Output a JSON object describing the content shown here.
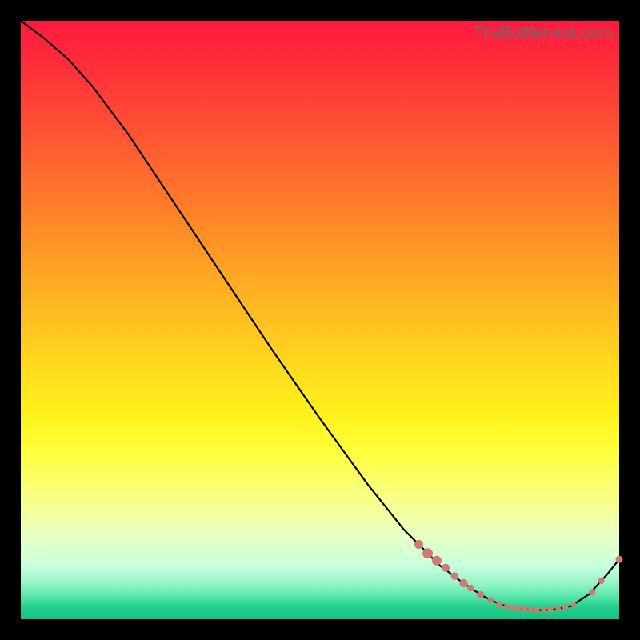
{
  "watermark": "TheBottleneck.com",
  "colors": {
    "curve": "#000000",
    "dot": "#cf7b70",
    "page_bg": "#000000"
  },
  "chart_data": {
    "type": "line",
    "title": "",
    "xlabel": "",
    "ylabel": "",
    "xlim": [
      0,
      100
    ],
    "ylim": [
      0,
      100
    ],
    "grid": false,
    "legend": false,
    "series": [
      {
        "name": "bottleneck-curve",
        "x": [
          0,
          4,
          8,
          12,
          18,
          26,
          34,
          42,
          50,
          58,
          64,
          70,
          74,
          77,
          80,
          83,
          86,
          89,
          92,
          95,
          98,
          100
        ],
        "y": [
          100,
          97,
          93.5,
          89,
          81,
          69,
          57,
          45,
          33.5,
          22.5,
          15,
          9,
          6,
          4,
          2.5,
          1.8,
          1.5,
          1.6,
          2.2,
          4.2,
          7.5,
          10
        ]
      }
    ],
    "markers": [
      {
        "x": 66.5,
        "y": 12.5,
        "r": 5.5
      },
      {
        "x": 68.0,
        "y": 11.0,
        "r": 6.5
      },
      {
        "x": 69.5,
        "y": 9.8,
        "r": 6.0
      },
      {
        "x": 71.0,
        "y": 8.6,
        "r": 5.0
      },
      {
        "x": 72.5,
        "y": 7.2,
        "r": 4.8
      },
      {
        "x": 74.0,
        "y": 6.0,
        "r": 5.2
      },
      {
        "x": 75.2,
        "y": 5.2,
        "r": 4.2
      },
      {
        "x": 76.8,
        "y": 4.1,
        "r": 4.6
      },
      {
        "x": 78.5,
        "y": 3.2,
        "r": 3.8
      },
      {
        "x": 80.0,
        "y": 2.5,
        "r": 4.2
      },
      {
        "x": 81.2,
        "y": 2.1,
        "r": 3.6
      },
      {
        "x": 82.2,
        "y": 1.9,
        "r": 4.0
      },
      {
        "x": 83.2,
        "y": 1.8,
        "r": 3.6
      },
      {
        "x": 84.2,
        "y": 1.7,
        "r": 3.8
      },
      {
        "x": 85.2,
        "y": 1.6,
        "r": 3.4
      },
      {
        "x": 86.2,
        "y": 1.5,
        "r": 3.8
      },
      {
        "x": 87.4,
        "y": 1.5,
        "r": 3.4
      },
      {
        "x": 88.5,
        "y": 1.6,
        "r": 3.8
      },
      {
        "x": 89.8,
        "y": 1.8,
        "r": 3.4
      },
      {
        "x": 91.0,
        "y": 2.0,
        "r": 3.8
      },
      {
        "x": 92.4,
        "y": 2.4,
        "r": 3.4
      },
      {
        "x": 95.5,
        "y": 4.5,
        "r": 4.2
      },
      {
        "x": 97.0,
        "y": 6.4,
        "r": 4.0
      },
      {
        "x": 100.0,
        "y": 10.0,
        "r": 4.5
      }
    ],
    "background_gradient": {
      "direction": "vertical",
      "stops": [
        {
          "pos": 0.0,
          "color": "#ff1a3f"
        },
        {
          "pos": 0.3,
          "color": "#ff7a2a"
        },
        {
          "pos": 0.56,
          "color": "#ffd41e"
        },
        {
          "pos": 0.72,
          "color": "#ffff3a"
        },
        {
          "pos": 0.91,
          "color": "#c9ffde"
        },
        {
          "pos": 1.0,
          "color": "#14c484"
        }
      ]
    }
  }
}
